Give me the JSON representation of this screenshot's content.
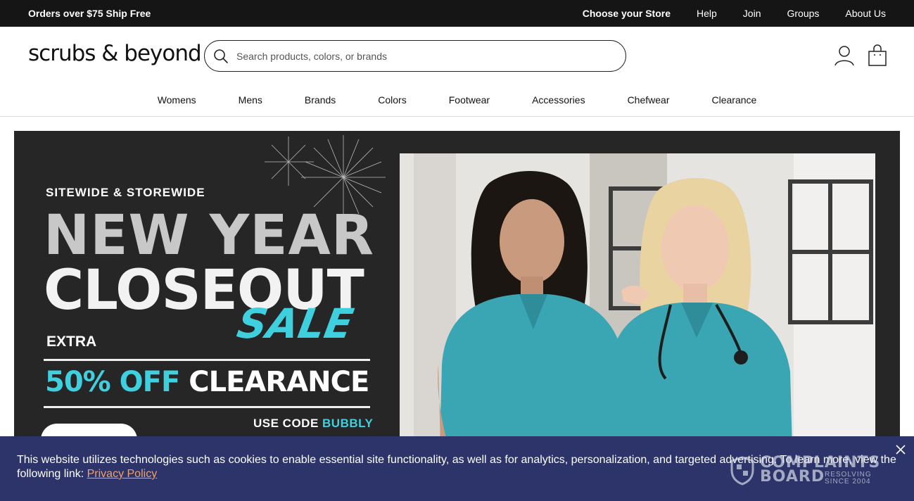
{
  "topbar": {
    "promo": "Orders over $75 Ship Free",
    "links": [
      "Choose your Store",
      "Help",
      "Join",
      "Groups",
      "About Us"
    ]
  },
  "header": {
    "logo": "scrubs & beyond",
    "search_placeholder": "Search products, colors, or brands",
    "icons": [
      "search-icon",
      "account-icon",
      "shopping-bag-icon"
    ]
  },
  "nav": {
    "items": [
      "Womens",
      "Mens",
      "Brands",
      "Colors",
      "Footwear",
      "Accessories",
      "Chefwear",
      "Clearance"
    ]
  },
  "hero": {
    "kicker": "SITEWIDE & STOREWIDE",
    "line1": "NEW YEAR",
    "line2": "CLOSEOUT",
    "sale": "SALE",
    "extra": "EXTRA",
    "offer_pct": "50% OFF",
    "offer_rest": "CLEARANCE",
    "code_prefix": "USE CODE",
    "code": "BUBBLY",
    "colors": {
      "teal": "#3fd0df",
      "bg": "#262626",
      "scrubs": "#3aa6b4"
    }
  },
  "cookie": {
    "text": "This website utilizes technologies such as cookies to enable essential site functionality, as well as for analytics, personalization, and targeted advertising. To learn more, view the following link: ",
    "link": "Privacy Policy",
    "bg_color": "#2c3469",
    "link_color": "#f3a06a"
  },
  "watermark": {
    "name_line1": "COMPLAINTS",
    "name_line2": "BOARD",
    "tag_line1": "RESOLVING",
    "tag_line2": "SINCE 2004"
  }
}
